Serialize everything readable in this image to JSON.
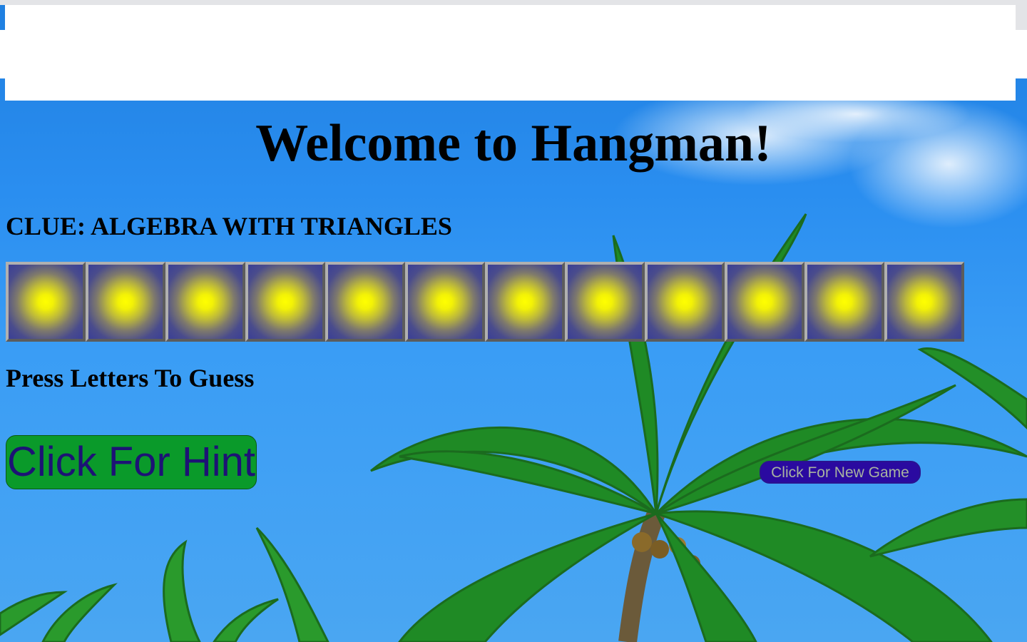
{
  "page": {
    "title": "Welcome to Hangman!",
    "clue_label": "CLUE:",
    "clue_text": "ALGEBRA WITH TRIANGLES",
    "instructions": "Press Letters To Guess"
  },
  "word": {
    "tile_count": 12,
    "revealed_letters": [
      "",
      "",
      "",
      "",
      "",
      "",
      "",
      "",
      "",
      "",
      "",
      ""
    ]
  },
  "buttons": {
    "hint_label": "Click For Hint",
    "new_game_label": "Click For New Game"
  },
  "colors": {
    "sky": "#2a8ef0",
    "hint_button_bg": "#0a9a2a",
    "hint_button_text": "#1d1275",
    "new_game_button_bg": "#2a0aa0",
    "new_game_button_text": "#a8b3a0",
    "tile_center": "#ffff00",
    "tile_edge": "#3a3f96"
  },
  "background_scene": "palm-trees-blue-sky"
}
